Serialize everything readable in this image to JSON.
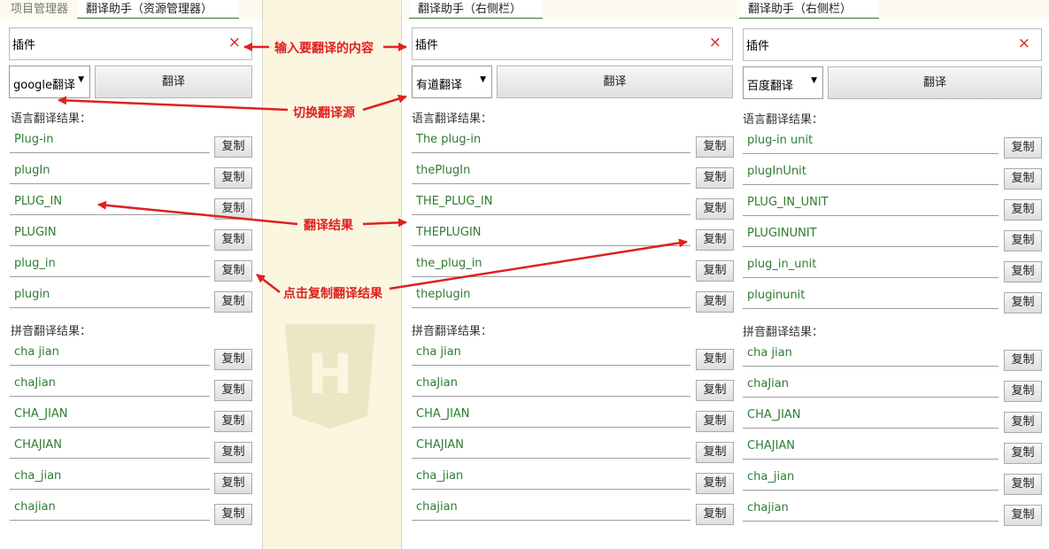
{
  "colors": {
    "result_text": "#2e7d32",
    "annotation": "#e02020",
    "editor_bg": "#faf6e0",
    "tab_underline": "#2e7d32"
  },
  "editor": {
    "watermark_icon": "html5-h-icon",
    "watermark_letter": "H"
  },
  "panel1": {
    "tabs": [
      "项目管理器",
      "翻译助手（资源管理器）"
    ],
    "input_value": "插件",
    "clear_icon": "×",
    "engine": "google翻译",
    "translate_label": "翻译",
    "lang_label": "语言翻译结果：",
    "lang_results": [
      "Plug-in",
      "plugIn",
      "PLUG_IN",
      "PLUGIN",
      "plug_in",
      "plugin"
    ],
    "pinyin_label": "拼音翻译结果：",
    "pinyin_results": [
      "cha jian",
      "chaJian",
      "CHA_JIAN",
      "CHAJIAN",
      "cha_jian",
      "chajian"
    ],
    "copy_label": "复制"
  },
  "panel2": {
    "tab": "翻译助手（右侧栏）",
    "input_value": "插件",
    "clear_icon": "×",
    "engine": "有道翻译",
    "translate_label": "翻译",
    "lang_label": "语言翻译结果：",
    "lang_results": [
      "The plug-in",
      "thePlugIn",
      "THE_PLUG_IN",
      "THEPLUGIN",
      "the_plug_in",
      "theplugin"
    ],
    "pinyin_label": "拼音翻译结果：",
    "pinyin_results": [
      "cha jian",
      "chaJian",
      "CHA_JIAN",
      "CHAJIAN",
      "cha_jian",
      "chajian"
    ],
    "copy_label": "复制"
  },
  "panel3": {
    "tab": "翻译助手（右侧栏）",
    "input_value": "插件",
    "clear_icon": "×",
    "engine": "百度翻译",
    "translate_label": "翻译",
    "lang_label": "语言翻译结果：",
    "lang_results": [
      "plug-in unit",
      "plugInUnit",
      "PLUG_IN_UNIT",
      "PLUGINUNIT",
      "plug_in_unit",
      "pluginunit"
    ],
    "pinyin_label": "拼音翻译结果：",
    "pinyin_results": [
      "cha jian",
      "chaJian",
      "CHA_JIAN",
      "CHAJIAN",
      "cha_jian",
      "chajian"
    ],
    "copy_label": "复制"
  },
  "annotations": {
    "input": "输入要翻译的内容",
    "switch_source": "切换翻译源",
    "results": "翻译结果",
    "click_copy": "点击复制翻译结果"
  }
}
